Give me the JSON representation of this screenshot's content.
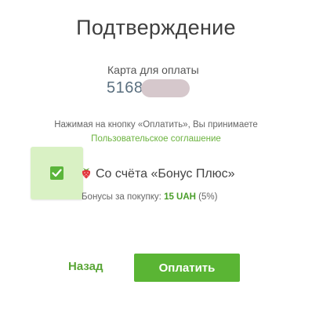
{
  "header": {
    "title": "Подтверждение"
  },
  "card": {
    "label": "Карта для оплаты",
    "number_prefix": "5168"
  },
  "terms": {
    "text": "Нажимая на кнопку «Оплатить», Вы принимаете",
    "link": "Пользовательское соглашение"
  },
  "bonus": {
    "checked": true,
    "icon": "strawberry-icon",
    "label": "Со счёта «Бонус Плюс»",
    "purchase_prefix": "Бонусы за покупку:",
    "amount": "15 UAH",
    "percent": "(5%)"
  },
  "actions": {
    "back_label": "Назад",
    "pay_label": "Оплатить"
  },
  "colors": {
    "accent": "#5ab534",
    "checkbox_tile": "#d9f1c4",
    "link": "#6cb33f"
  }
}
